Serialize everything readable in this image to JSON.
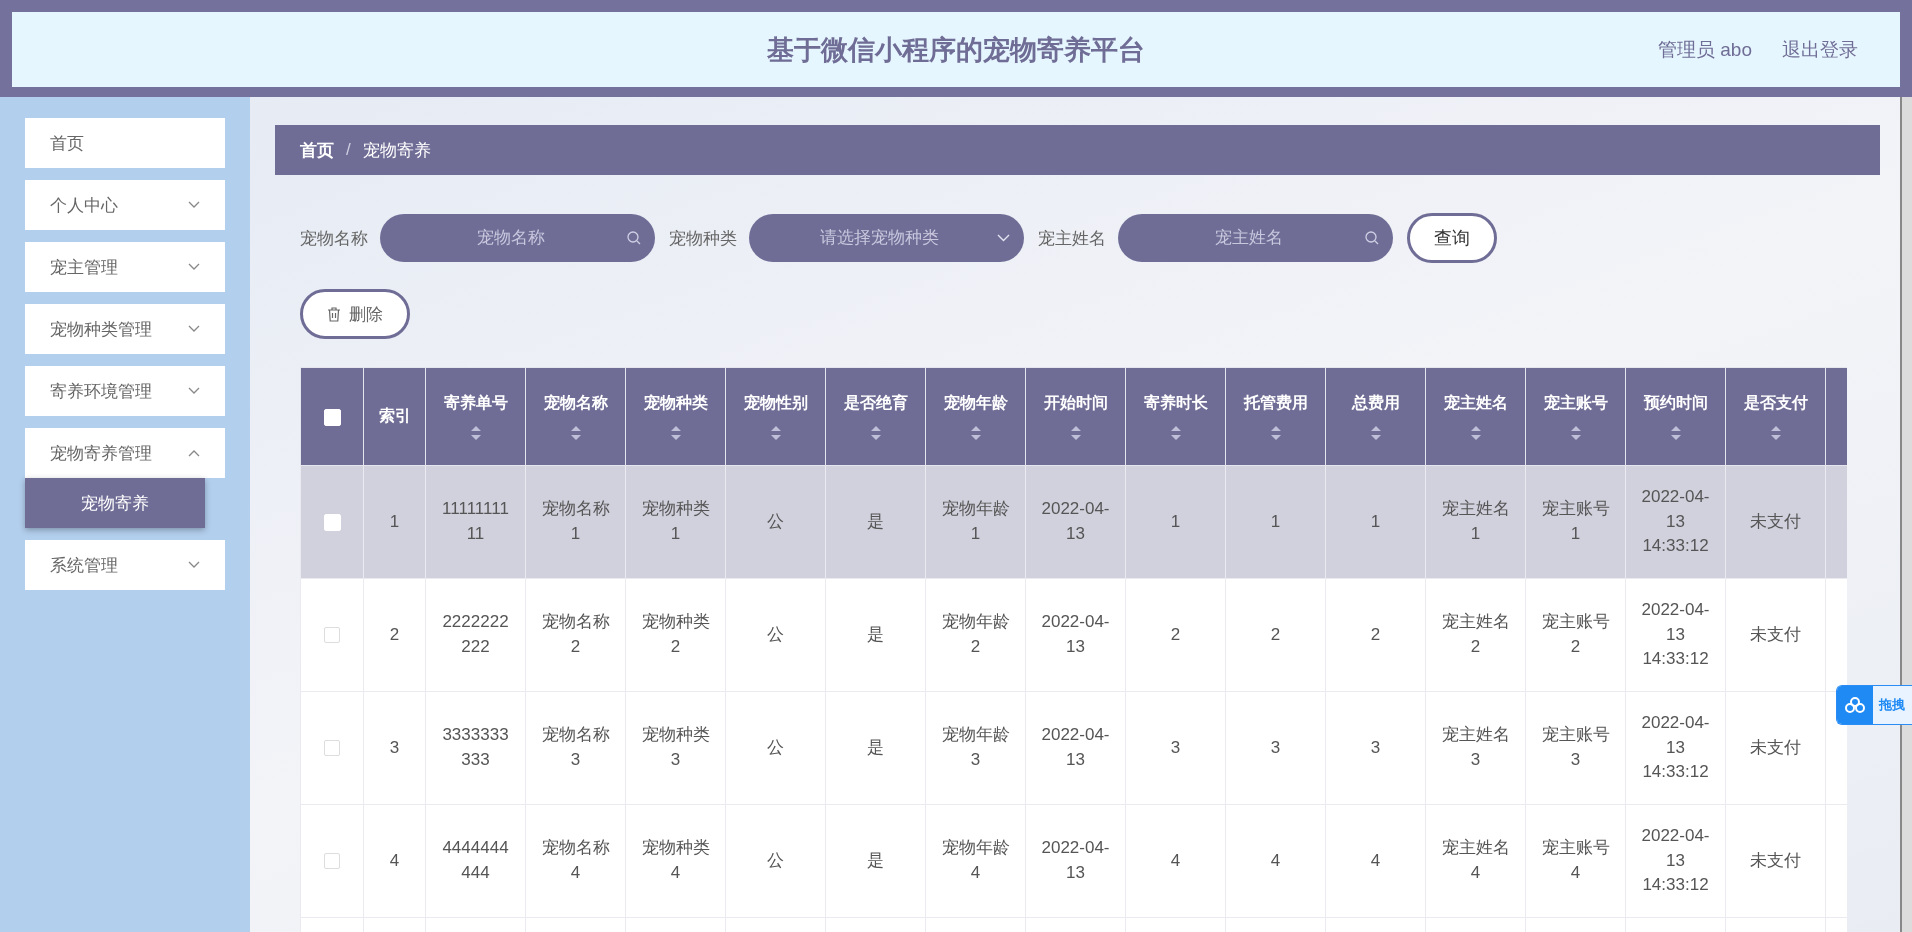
{
  "header": {
    "title": "基于微信小程序的宠物寄养平台",
    "user": "管理员 abo",
    "logout": "退出登录"
  },
  "sidebar": {
    "items": [
      {
        "label": "首页",
        "expandable": false
      },
      {
        "label": "个人中心",
        "expandable": true,
        "expanded": false
      },
      {
        "label": "宠主管理",
        "expandable": true,
        "expanded": false
      },
      {
        "label": "宠物种类管理",
        "expandable": true,
        "expanded": false
      },
      {
        "label": "寄养环境管理",
        "expandable": true,
        "expanded": false
      },
      {
        "label": "宠物寄养管理",
        "expandable": true,
        "expanded": true,
        "children": [
          {
            "label": "宠物寄养",
            "selected": true
          }
        ]
      },
      {
        "label": "系统管理",
        "expandable": true,
        "expanded": false
      }
    ]
  },
  "breadcrumb": [
    "首页",
    "宠物寄养"
  ],
  "breadcrumb_separator": "/",
  "filters": [
    {
      "kind": "search",
      "label": "宠物名称",
      "placeholder": "宠物名称"
    },
    {
      "kind": "select",
      "label": "宠物种类",
      "placeholder": "请选择宠物种类"
    },
    {
      "kind": "search",
      "label": "宠主姓名",
      "placeholder": "宠主姓名"
    }
  ],
  "query_button": "查询",
  "delete_button": "删除",
  "table": {
    "header_checked": false,
    "columns": [
      {
        "label": "索引",
        "sortable": false
      },
      {
        "label": "寄养单号",
        "sortable": true
      },
      {
        "label": "宠物名称",
        "sortable": true
      },
      {
        "label": "宠物种类",
        "sortable": true
      },
      {
        "label": "宠物性别",
        "sortable": true
      },
      {
        "label": "是否绝育",
        "sortable": true
      },
      {
        "label": "宠物年龄",
        "sortable": true
      },
      {
        "label": "开始时间",
        "sortable": true
      },
      {
        "label": "寄养时长",
        "sortable": true
      },
      {
        "label": "托管费用",
        "sortable": true
      },
      {
        "label": "总费用",
        "sortable": true
      },
      {
        "label": "宠主姓名",
        "sortable": true
      },
      {
        "label": "宠主账号",
        "sortable": true
      },
      {
        "label": "预约时间",
        "sortable": true
      },
      {
        "label": "是否支付",
        "sortable": true
      }
    ],
    "rows": [
      {
        "highlighted": true,
        "checked": false,
        "cells": [
          "1",
          "1111111111",
          "宠物名称1",
          "宠物种类1",
          "公",
          "是",
          "宠物年龄1",
          "2022-04-13",
          "1",
          "1",
          "1",
          "宠主姓名1",
          "宠主账号1",
          "2022-04-13 14:33:12",
          "未支付"
        ]
      },
      {
        "highlighted": false,
        "checked": false,
        "cells": [
          "2",
          "2222222222",
          "宠物名称2",
          "宠物种类2",
          "公",
          "是",
          "宠物年龄2",
          "2022-04-13",
          "2",
          "2",
          "2",
          "宠主姓名2",
          "宠主账号2",
          "2022-04-13 14:33:12",
          "未支付"
        ]
      },
      {
        "highlighted": false,
        "checked": false,
        "cells": [
          "3",
          "3333333333",
          "宠物名称3",
          "宠物种类3",
          "公",
          "是",
          "宠物年龄3",
          "2022-04-13",
          "3",
          "3",
          "3",
          "宠主姓名3",
          "宠主账号3",
          "2022-04-13 14:33:12",
          "未支付"
        ]
      },
      {
        "highlighted": false,
        "checked": false,
        "cells": [
          "4",
          "4444444444",
          "宠物名称4",
          "宠物种类4",
          "公",
          "是",
          "宠物年龄4",
          "2022-04-13",
          "4",
          "4",
          "4",
          "宠主姓名4",
          "宠主账号4",
          "2022-04-13 14:33:12",
          "未支付"
        ]
      }
    ]
  },
  "drop_widget": {
    "label": "拖拽"
  }
}
